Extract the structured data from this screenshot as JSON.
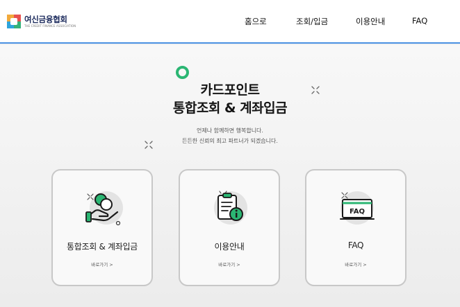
{
  "header": {
    "logo_name": "여신금융협회",
    "logo_sub": "THE CREDIT FINANCE ASSOCIATION",
    "nav": [
      "홈으로",
      "조회/입금",
      "이용안내",
      "FAQ"
    ]
  },
  "hero": {
    "title_line1": "카드포인트",
    "title_line2": "통합조회 & 계좌입금",
    "sub_line1": "언제나 함께하면 행복합니다.",
    "sub_line2": "든든한 신뢰의 최고 파트너가 되겠습니다."
  },
  "cards": [
    {
      "title": "통합조회 & 계좌입금",
      "link": "바로가기 >",
      "icon": "coin-in-hand-icon"
    },
    {
      "title": "이용안내",
      "link": "바로가기 >",
      "icon": "clipboard-info-icon"
    },
    {
      "title": "FAQ",
      "link": "바로가기 >",
      "icon": "faq-monitor-icon"
    }
  ],
  "colors": {
    "accent_green": "#2bb673",
    "header_line": "#4a90e2",
    "logo_navy": "#1b2a5c"
  }
}
